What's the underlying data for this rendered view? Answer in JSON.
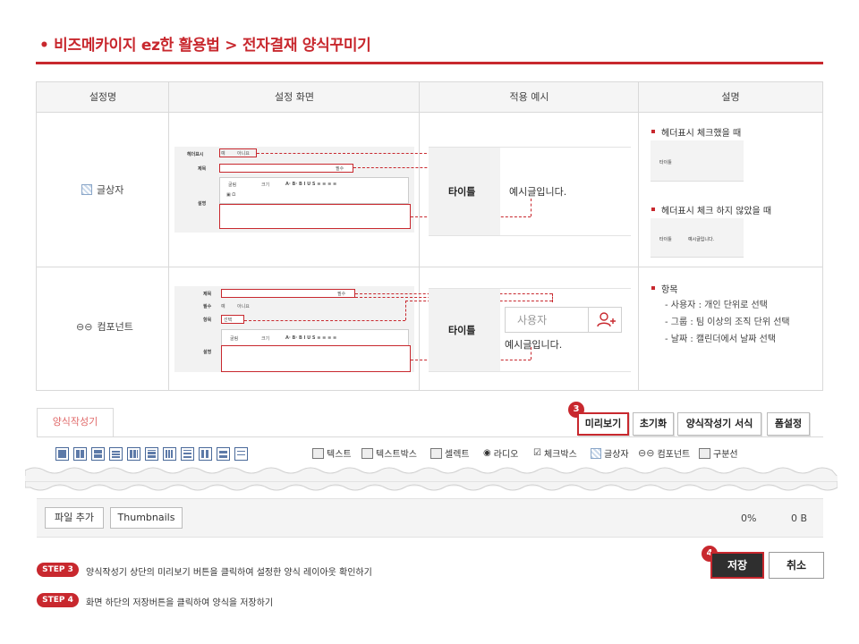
{
  "header": {
    "title": "• 비즈메카이지 ez한 활용법 > 전자결재 양식꾸미기"
  },
  "table": {
    "headers": [
      "설정명",
      "설정 화면",
      "적용 예시",
      "설명"
    ],
    "rows": [
      {
        "name": "글상자",
        "icon": "textarea-grid-icon",
        "mini": {
          "label_header": "헤더표시",
          "radio_yes": "예",
          "radio_no": "아니요",
          "label_title": "제목",
          "required": "필수",
          "label_desc": "설명",
          "toolbar_font": "굴림",
          "toolbar_size": "크기"
        },
        "preview": {
          "title": "타이틀",
          "text": "예시글입니다."
        },
        "desc": {
          "item1": "헤더표시 체크했을 때",
          "thumb1_title": "타이틀",
          "item2": "헤더표시 체크 하지 않았을 때",
          "thumb2_title": "타이틀",
          "thumb2_text": "예시글입니다."
        }
      },
      {
        "name": "컴포넌트",
        "icon": "chain-link-icon",
        "mini": {
          "label_title": "제목",
          "required": "필수",
          "label_required": "필수",
          "radio_yes": "예",
          "radio_no": "아니요",
          "label_item": "항목",
          "select_value": "선택",
          "label_desc": "설명",
          "toolbar_font": "굴림",
          "toolbar_size": "크기"
        },
        "preview": {
          "title": "타이틀",
          "placeholder": "사용자",
          "text": "예시글입니다."
        },
        "desc": {
          "item1": "항목",
          "sub1": "- 사용자 : 개인 단위로 선택",
          "sub2": "- 그룹 : 팀 이상의 조직 단위 선택",
          "sub3": "- 날짜 : 캘린더에서 날짜 선택"
        }
      }
    ]
  },
  "builder": {
    "tab": "양식작성기",
    "badge3": "3",
    "buttons": {
      "preview": "미리보기",
      "reset": "초기화",
      "format": "양식작성기 서식",
      "form_settings": "폼설정"
    },
    "tools": [
      "텍스트",
      "텍스트박스",
      "셀렉트",
      "라디오",
      "체크박스",
      "글상자",
      "컴포넌트",
      "구분선"
    ],
    "file_add": "파일 추가",
    "thumbnails": "Thumbnails",
    "percent": "0%",
    "size": "0 B"
  },
  "steps": [
    {
      "tag": "STEP 3",
      "text": "양식작성기 상단의 미리보기 버튼을 클릭하여 설정한 양식 레이아웃 확인하기"
    },
    {
      "tag": "STEP 4",
      "text": "화면 하단의 저장버튼을 클릭하여 양식을 저장하기"
    }
  ],
  "actions": {
    "badge4": "4",
    "save": "저장",
    "cancel": "취소"
  },
  "colors": {
    "accent": "#c8282e",
    "dark": "#2f2f2f"
  }
}
